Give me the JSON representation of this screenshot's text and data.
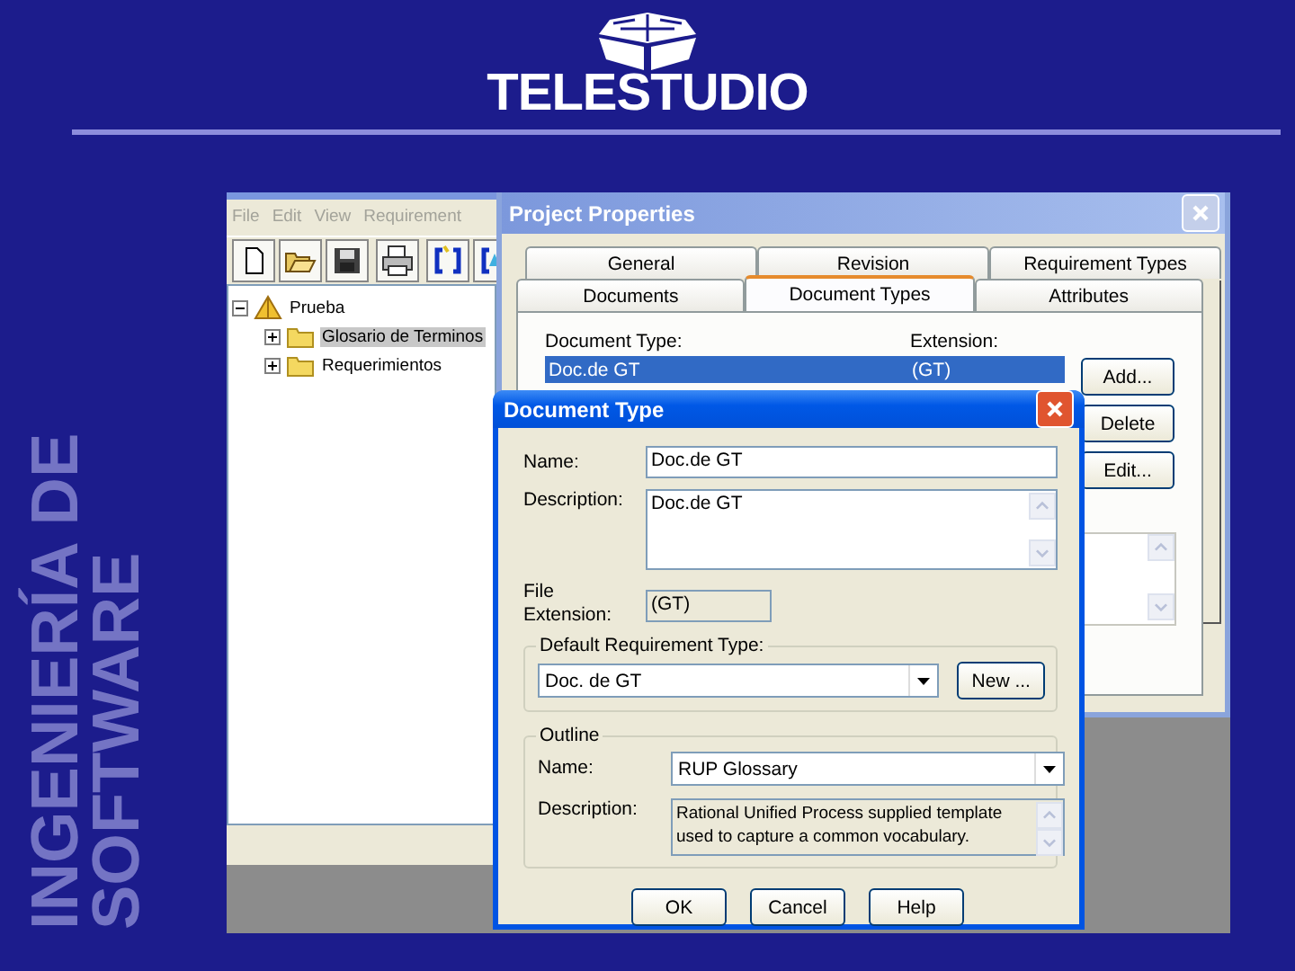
{
  "slide": {
    "logo_text": "TELESTUDIO",
    "side_title_lines": [
      "INGENIERÍA DE",
      "SOFTWARE"
    ]
  },
  "app_window": {
    "menu": [
      "File",
      "Edit",
      "View",
      "Requirement"
    ],
    "tree": [
      {
        "label": "Prueba",
        "expanded": true,
        "selected": false,
        "children": [
          {
            "label": "Glosario de Terminos",
            "expanded": false,
            "selected": true
          },
          {
            "label": "Requerimientos",
            "expanded": false,
            "selected": false
          }
        ]
      }
    ]
  },
  "project_properties": {
    "title": "Project Properties",
    "tab_rows": [
      [
        {
          "label": "General",
          "selected": false
        },
        {
          "label": "Revision",
          "selected": false
        },
        {
          "label": "Requirement Types",
          "selected": false
        }
      ],
      [
        {
          "label": "Documents",
          "selected": false
        },
        {
          "label": "Document Types",
          "selected": true
        },
        {
          "label": "Attributes",
          "selected": false
        }
      ]
    ],
    "columns": [
      "Document Type:",
      "Extension:"
    ],
    "rows": [
      {
        "document_type": "Doc.de GT",
        "extension": "(GT)",
        "selected": true
      }
    ],
    "buttons": [
      "Add...",
      "Delete",
      "Edit..."
    ]
  },
  "document_type_dialog": {
    "title": "Document Type",
    "name_label": "Name:",
    "name_value": "Doc.de GT",
    "description_label": "Description:",
    "description_value": "Doc.de GT",
    "file_extension_label": "File Extension:",
    "file_extension_value": "(GT)",
    "default_requirement_type": {
      "label": "Default Requirement Type:",
      "value": "Doc. de GT",
      "button": "New ..."
    },
    "outline": {
      "label": "Outline",
      "name_label": "Name:",
      "name_value": "RUP Glossary",
      "description_label": "Description:",
      "description_value": "Rational Unified Process supplied template used to capture a common vocabulary."
    },
    "buttons": [
      "OK",
      "Cancel",
      "Help"
    ]
  }
}
